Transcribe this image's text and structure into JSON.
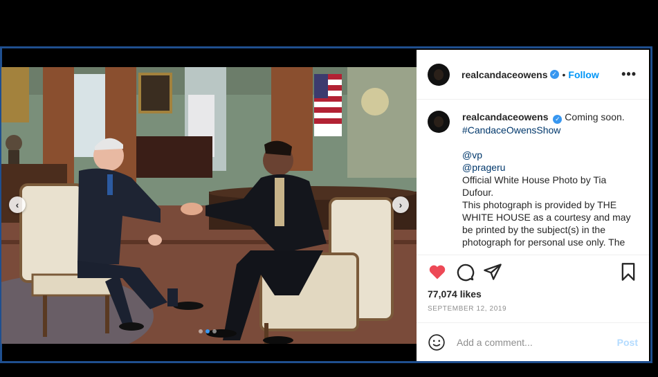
{
  "header": {
    "username": "realcandaceowens",
    "separator": "•",
    "follow_label": "Follow",
    "more_label": "•••"
  },
  "caption": {
    "username": "realcandaceowens",
    "text_start": "Coming soon.",
    "hashtag": "#CandaceOwensShow",
    "mentions": [
      "@vp",
      "@prageru"
    ],
    "lines": [
      "Official White House Photo by Tia Dufour.",
      "This photograph is provided by THE WHITE HOUSE as a courtesy and may be printed by the subject(s) in the photograph for personal use only. The"
    ]
  },
  "post": {
    "likes": "77,074 likes",
    "date": "SEPTEMBER 12, 2019",
    "liked": true,
    "carousel_index": 2,
    "carousel_total": 3
  },
  "comment_box": {
    "placeholder": "Add a comment...",
    "post_label": "Post"
  },
  "carousel": {
    "prev_label": "‹",
    "next_label": "›"
  },
  "colors": {
    "frame_border": "#1f4f8f",
    "link_blue": "#0095f6",
    "heart_red": "#ed4956",
    "verified_blue": "#3897f0",
    "post_disabled": "#b3dbff"
  },
  "icons": [
    "verified-badge-icon",
    "heart-icon",
    "comment-icon",
    "share-icon",
    "bookmark-icon",
    "emoji-icon",
    "chevron-left-icon",
    "chevron-right-icon"
  ]
}
